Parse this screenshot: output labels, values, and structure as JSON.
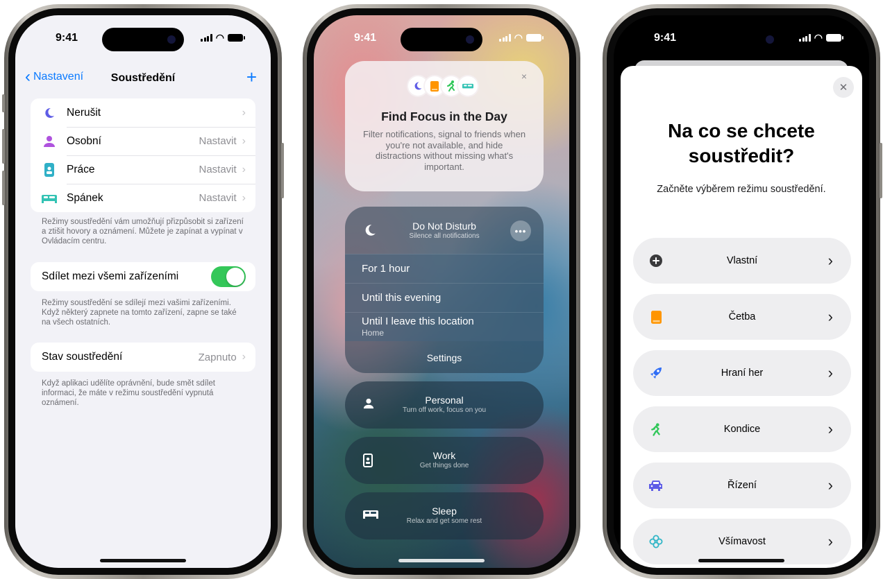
{
  "status": {
    "time": "9:41"
  },
  "settings": {
    "nav_back": "Nastavení",
    "nav_title": "Soustředění",
    "nav_add": "+",
    "modes": [
      {
        "label": "Nerušit",
        "value": "",
        "icon": "moon-icon",
        "color": "#5e5ce6"
      },
      {
        "label": "Osobní",
        "value": "Nastavit",
        "icon": "person-icon",
        "color": "#af52de"
      },
      {
        "label": "Práce",
        "value": "Nastavit",
        "icon": "badge-icon",
        "color": "#30b0c7"
      },
      {
        "label": "Spánek",
        "value": "Nastavit",
        "icon": "bed-icon",
        "color": "#34c3b4"
      }
    ],
    "modes_footnote": "Režimy soustředění vám umožňují přizpůsobit si zařízení a ztišit hovory a oznámení. Můžete je zapínat a vypínat v Ovládacím centru.",
    "share_label": "Sdílet mezi všemi zařízeními",
    "share_on": true,
    "share_footnote": "Režimy soustředění se sdílejí mezi vašimi zařízeními. Když některý zapnete na tomto zařízení, zapne se také na všech ostatních.",
    "status_label": "Stav soustředění",
    "status_value": "Zapnuto",
    "status_footnote": "Když aplikaci udělíte oprávnění, bude smět sdílet informaci, že máte v režimu soustředění vypnutá oznámení.",
    "accent": "#0a7aff"
  },
  "control_center": {
    "promo": {
      "title": "Find Focus in the Day",
      "body": "Filter notifications, signal to friends when you're not available, and hide distractions without missing what's important.",
      "close": "×"
    },
    "dnd": {
      "title": "Do Not Disturb",
      "subtitle": "Silence all notifications",
      "more": "•••",
      "options": [
        "For 1 hour",
        "Until this evening"
      ],
      "location_option": "Until I leave this location",
      "location_sub": "Home",
      "settings": "Settings"
    },
    "modes": [
      {
        "title": "Personal",
        "subtitle": "Turn off work, focus on you",
        "icon": "person-icon"
      },
      {
        "title": "Work",
        "subtitle": "Get things done",
        "icon": "badge-icon"
      },
      {
        "title": "Sleep",
        "subtitle": "Relax and get some rest",
        "icon": "bed-icon"
      }
    ]
  },
  "sheet": {
    "close": "✕",
    "title_line1": "Na co se chcete",
    "title_line2": "soustředit?",
    "subtitle": "Začněte výběrem režimu soustředění.",
    "options": [
      {
        "label": "Vlastní",
        "icon": "plus-circle-icon",
        "color": "#3a3a3c"
      },
      {
        "label": "Četba",
        "icon": "book-icon",
        "color": "#ff9500"
      },
      {
        "label": "Hraní her",
        "icon": "rocket-icon",
        "color": "#2f6df6"
      },
      {
        "label": "Kondice",
        "icon": "running-icon",
        "color": "#30c759"
      },
      {
        "label": "Řízení",
        "icon": "car-icon",
        "color": "#5e5ce6"
      },
      {
        "label": "Všímavost",
        "icon": "flower-icon",
        "color": "#30b6c7"
      }
    ]
  }
}
